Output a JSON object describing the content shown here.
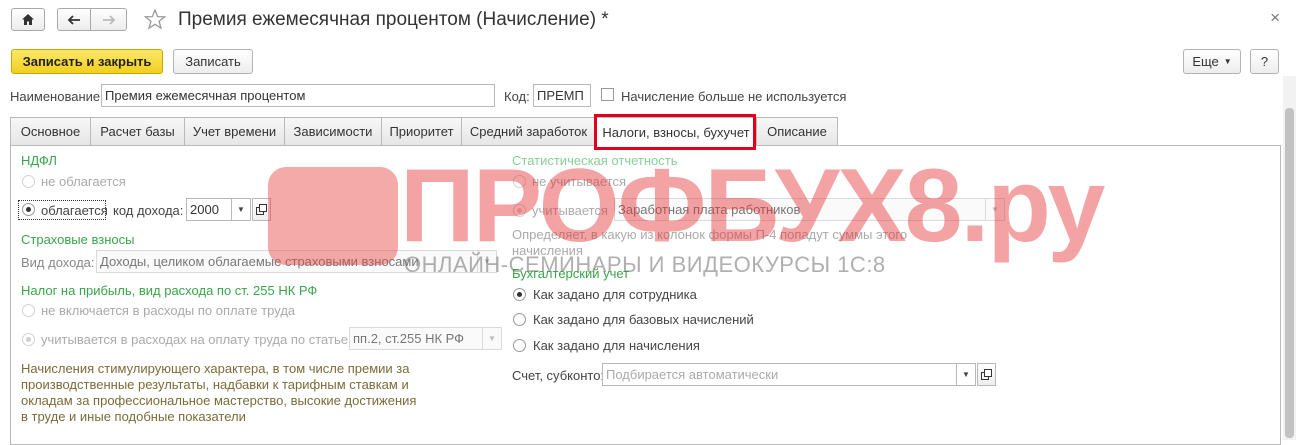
{
  "window": {
    "title": "Премия ежемесячная процентом (Начисление) *",
    "close_glyph": "×"
  },
  "toolbar": {
    "save_close_label": "Записать и закрыть",
    "save_label": "Записать",
    "more_label": "Еще",
    "help_label": "?"
  },
  "header": {
    "name_label": "Наименование:",
    "name_value": "Премия ежемесячная процентом",
    "code_label": "Код:",
    "code_value": "ПРЕМП",
    "unused_label": "Начисление больше не используется"
  },
  "tabs": [
    {
      "label": "Основное"
    },
    {
      "label": "Расчет базы"
    },
    {
      "label": "Учет времени"
    },
    {
      "label": "Зависимости"
    },
    {
      "label": "Приоритет"
    },
    {
      "label": "Средний заработок"
    },
    {
      "label": "Налоги, взносы, бухучет"
    },
    {
      "label": "Описание"
    }
  ],
  "left": {
    "ndfl_title": "НДФЛ",
    "ndfl_not_taxed": "не облагается",
    "ndfl_taxed": "облагается",
    "income_code_label": "код дохода:",
    "income_code_value": "2000",
    "insurance_title": "Страховые взносы",
    "income_type_label": "Вид дохода:",
    "income_type_value": "Доходы, целиком облагаемые страховыми взносами",
    "profit_tax_title": "Налог на прибыль, вид расхода по ст. 255 НК РФ",
    "not_included": "не включается в расходы по оплате труда",
    "included": "учитывается в расходах на оплату труда по статье:",
    "article_value": "пп.2, ст.255 НК РФ",
    "description": [
      "Начисления стимулирующего характера, в том числе премии за",
      "производственные результаты, надбавки к тарифным ставкам и",
      "окладам за профессиональное мастерство, высокие достижения",
      "в труде и иные подобные показатели"
    ]
  },
  "right": {
    "stat_title": "Статистическая отчетность",
    "stat_not_counted": "не учитывается",
    "stat_counted": "учитывается",
    "stat_value": "Заработная плата работников",
    "stat_note": [
      "Определяет, в какую из колонок формы П-4 попадут суммы этого",
      "начисления"
    ],
    "acc_title": "Бухгалтерский учет",
    "acc_opt1": "Как задано для сотрудника",
    "acc_opt2": "Как задано для базовых начислений",
    "acc_opt3": "Как задано для начисления",
    "account_label": "Счет, субконто:",
    "account_placeholder": "Подбирается автоматически"
  },
  "watermark": {
    "brand": "ПРОФБУХ8.ру",
    "tagline": "ОНЛАЙН-СЕМИНАРЫ И ВИДЕОКУРСЫ 1С:8"
  },
  "colors": {
    "accent_green": "#3aa54a",
    "primary_button": "#f2cf1c",
    "highlight_red": "#e0001b"
  }
}
